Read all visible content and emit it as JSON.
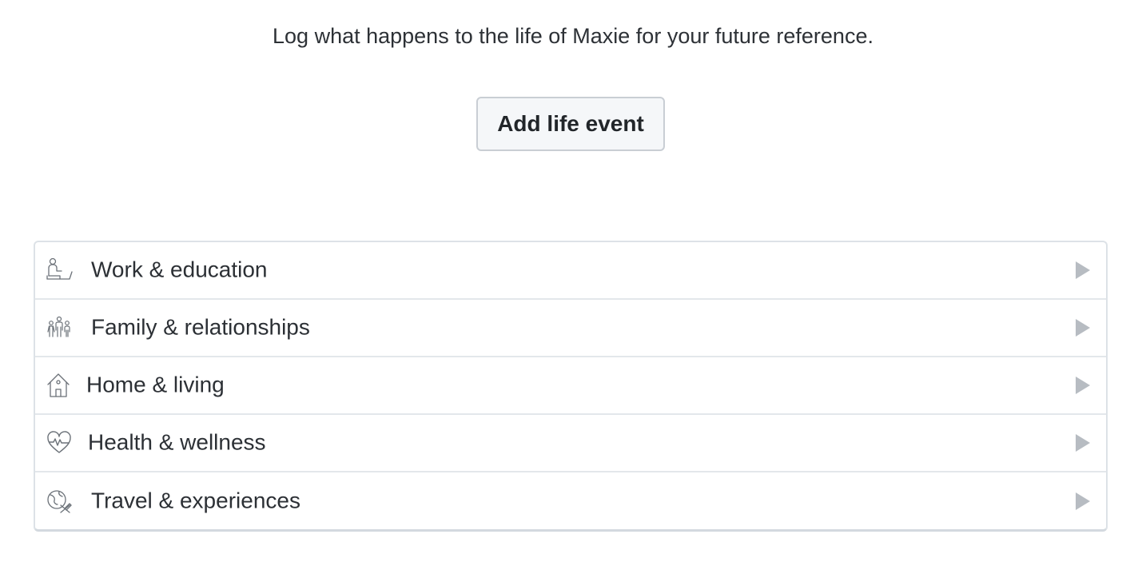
{
  "intro": {
    "text": "Log what happens to the life of Maxie for your future reference."
  },
  "actions": {
    "add_life_event_label": "Add life event"
  },
  "categories": [
    {
      "label": "Work & education",
      "icon": "work-education-icon"
    },
    {
      "label": "Family & relationships",
      "icon": "family-icon"
    },
    {
      "label": "Home & living",
      "icon": "home-icon"
    },
    {
      "label": "Health & wellness",
      "icon": "heart-pulse-icon"
    },
    {
      "label": "Travel & experiences",
      "icon": "globe-plane-icon"
    }
  ],
  "colors": {
    "text": "#2c3035",
    "border": "#dde2e7",
    "button_bg": "#f5f7f9",
    "chevron": "#b7bcc2",
    "icon_stroke": "#6b7178"
  }
}
